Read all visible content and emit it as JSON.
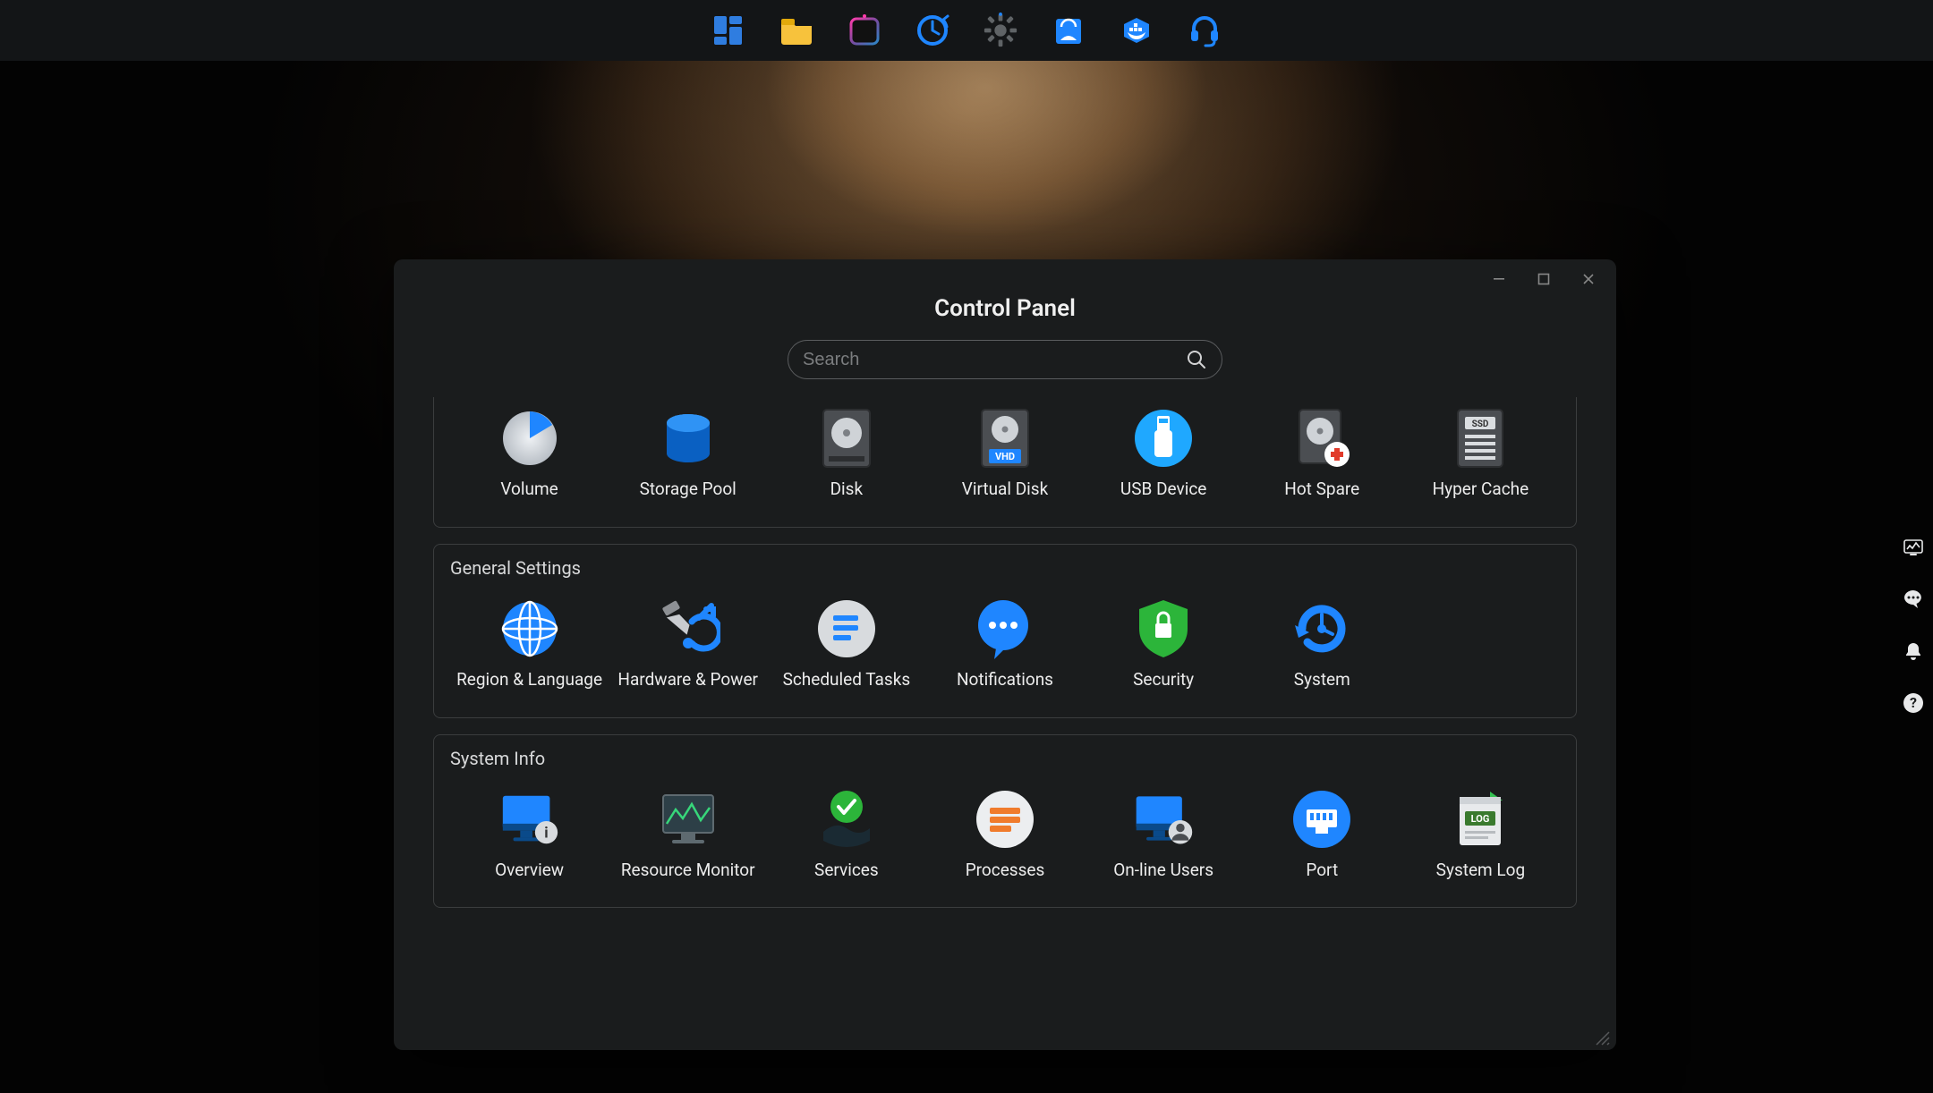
{
  "taskbar": {
    "items": [
      {
        "name": "app-launcher"
      },
      {
        "name": "file-manager"
      },
      {
        "name": "media-app"
      },
      {
        "name": "clock-app"
      },
      {
        "name": "settings-app"
      },
      {
        "name": "store-app"
      },
      {
        "name": "docker-app"
      },
      {
        "name": "support-app"
      }
    ]
  },
  "side": {
    "items": [
      {
        "name": "dashboard-widget"
      },
      {
        "name": "chat-widget"
      },
      {
        "name": "notifications-widget"
      },
      {
        "name": "help-widget"
      }
    ]
  },
  "window": {
    "title": "Control Panel",
    "search_placeholder": "Search"
  },
  "groups": [
    {
      "id": "storage",
      "title": "",
      "items": [
        {
          "id": "volume",
          "label": "Volume"
        },
        {
          "id": "storage-pool",
          "label": "Storage Pool"
        },
        {
          "id": "disk",
          "label": "Disk"
        },
        {
          "id": "virtual-disk",
          "label": "Virtual Disk"
        },
        {
          "id": "usb-device",
          "label": "USB Device"
        },
        {
          "id": "hot-spare",
          "label": "Hot Spare"
        },
        {
          "id": "hyper-cache",
          "label": "Hyper Cache"
        }
      ]
    },
    {
      "id": "general-settings",
      "title": "General Settings",
      "items": [
        {
          "id": "region-language",
          "label": "Region & Language"
        },
        {
          "id": "hardware-power",
          "label": "Hardware & Power"
        },
        {
          "id": "scheduled-tasks",
          "label": "Scheduled Tasks"
        },
        {
          "id": "notifications",
          "label": "Notifications"
        },
        {
          "id": "security",
          "label": "Security"
        },
        {
          "id": "system",
          "label": "System"
        }
      ]
    },
    {
      "id": "system-info",
      "title": "System Info",
      "items": [
        {
          "id": "overview",
          "label": "Overview"
        },
        {
          "id": "resource-monitor",
          "label": "Resource Monitor"
        },
        {
          "id": "services",
          "label": "Services"
        },
        {
          "id": "processes",
          "label": "Processes"
        },
        {
          "id": "online-users",
          "label": "On-line Users"
        },
        {
          "id": "port",
          "label": "Port"
        },
        {
          "id": "system-log",
          "label": "System Log"
        }
      ]
    }
  ]
}
